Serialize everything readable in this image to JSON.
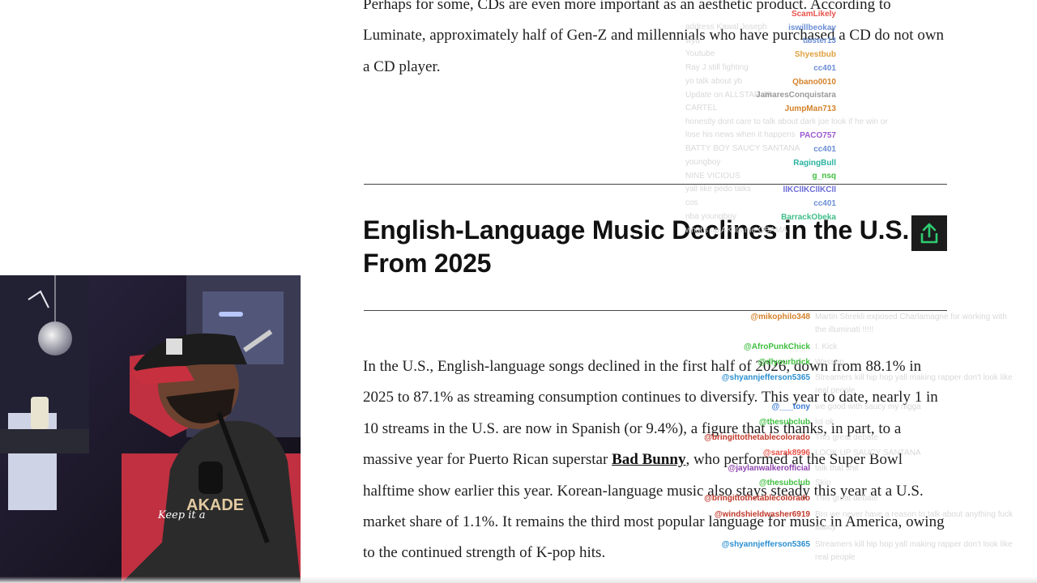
{
  "article": {
    "para1": "Perhaps for some, CDs are even more important as an aesthetic product. According to Luminate, approximately half of Gen-Z and millennials who have purchased a CD do not own a CD player.",
    "heading": "English-Language Music Declines in the U.S. From 2025",
    "para2_a": "In the U.S., English-language songs declined in the first half of 2026, down from 88.1% in 2025 to 87.1% as streaming consumption continues to diversify. This year to date, nearly 1 in 10 streams in the U.S. are now in Spanish (or 9.4%), a figure that is thanks, in part, to a massive year for Puerto Rican superstar ",
    "para2_link": "Bad Bunny",
    "para2_b": ", who performed at the Super Bowl halftime show earlier this year. Korean-language music also stays steady this year at a U.S. market share of 1.1%. It remains the third most popular language for music in America, owing to the continued strength of K-pop hits."
  },
  "share_icon": "share-upload-icon",
  "webcam": {
    "shirt_text": "AKADE",
    "shirt_script": "Keep it a"
  },
  "chat_top": [
    {
      "user": "ScamLikely",
      "color": "#e8524a",
      "msg": "address Kawal Joseph"
    },
    {
      "user": "iswillbeokay",
      "color": "#6c8fd6",
      "msg": "wya"
    },
    {
      "user": "taister13",
      "color": "#6c8fd6",
      "msg": "Youtube"
    },
    {
      "user": "Shyestbub",
      "color": "#e0a040",
      "msg": "Ray J still fighting"
    },
    {
      "user": "cc401",
      "color": "#6c8fd6",
      "msg": "yo talk about yb"
    },
    {
      "user": "Qbano0010",
      "color": "#d4822a",
      "msg": "Update on ALLSTAR JR"
    },
    {
      "user": "JamaresConquistara",
      "color": "#9a9a9a",
      "msg": "CARTEL"
    },
    {
      "user": "JumpMan713",
      "color": "#d4822a",
      "msg": "honestly dont care to talk about dark joe look if he win or lose his news when it happens"
    },
    {
      "user": "PACO757",
      "color": "#9b59d0",
      "msg": "BATTY BOY SAUCY SANTANA"
    },
    {
      "user": "cc401",
      "color": "#6c8fd6",
      "msg": "youngboy"
    },
    {
      "user": "RagingBull",
      "color": "#2bb3a0",
      "msg": "NINE VICIOUS"
    },
    {
      "user": "g_nsq",
      "color": "#3fbf3f",
      "msg": "yall like pedo talks"
    },
    {
      "user": "llKCllKCllKCll",
      "color": "#6a6ad6",
      "msg": "cos"
    },
    {
      "user": "cc401",
      "color": "#6c8fd6",
      "msg": "nba youngboy"
    },
    {
      "user": "BarrackObeka",
      "color": "#3fbf8a",
      "msg": "what's up AK its me OBAMA"
    }
  ],
  "chat_bottom": [
    {
      "user": "@mikophilo348",
      "color": "#d4822a",
      "msg": "Martin Shrekli exposed Charlamagne for working with the illuminati !!!!!"
    },
    {
      "user": "@AfroPunkChick",
      "color": "#3fbf3f",
      "msg": "I. Kick"
    },
    {
      "user": "@dlyourbrick",
      "color": "#3fbf3f",
      "msg": "Wassup"
    },
    {
      "user": "@shyannjefferson5365",
      "color": "#2b8fd0",
      "msg": "Streamers kill hip hop yall making rapper don't look like real people"
    },
    {
      "user": "@___tony",
      "color": "#3a7ad6",
      "msg": "we good with saucy my nigga"
    },
    {
      "user": "@thesubclub",
      "color": "#3fbf3f",
      "msg": "lol ok"
    },
    {
      "user": "@bringittothetablecolorado",
      "color": "#c0392b",
      "msg": "This great debate"
    },
    {
      "user": "@sarak8996",
      "color": "#e8524a",
      "msg": "LOOK UP SAUCY SANTANA"
    },
    {
      "user": "@jaylanwalkerofficial",
      "color": "#8e44ad",
      "msg": "talk that shit"
    },
    {
      "user": "@thesubclub",
      "color": "#3fbf3f",
      "msg": "Skip"
    },
    {
      "user": "@bringittothetablecolorado",
      "color": "#c0392b",
      "msg": "This great debate"
    },
    {
      "user": "@windshieldwasher6919",
      "color": "#c0392b",
      "msg": "Bro we never have a reason to talk about anything fuck saucy"
    },
    {
      "user": "@shyannjefferson5365",
      "color": "#2b8fd0",
      "msg": "Streamers kill hip hop yall making rapper don't look like real people"
    }
  ]
}
